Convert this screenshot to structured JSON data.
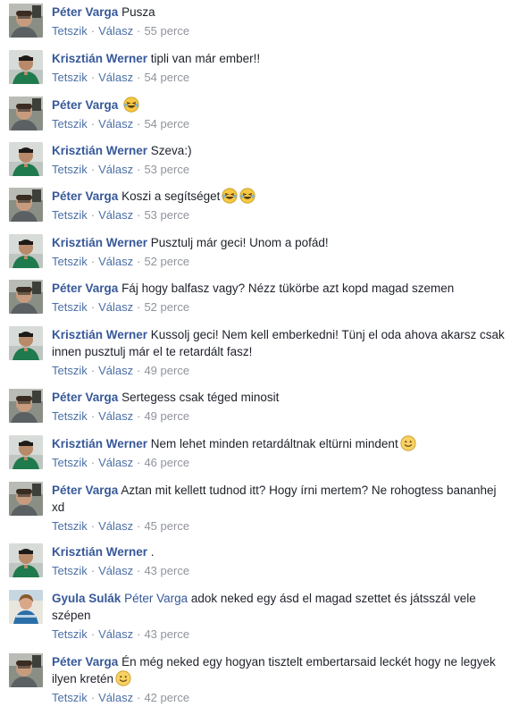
{
  "actions": {
    "like": "Tetszik",
    "reply": "Válasz",
    "separator": "·"
  },
  "comments": [
    {
      "author": "Péter Varga",
      "mention": "",
      "text": "Pusza",
      "emoji": [],
      "time": "55 perce",
      "avatar": "peter-avatar"
    },
    {
      "author": "Krisztián Werner",
      "mention": "",
      "text": "tipli van már ember!!",
      "emoji": [],
      "time": "54 perce",
      "avatar": "krisztian-avatar"
    },
    {
      "author": "Péter Varga",
      "mention": "",
      "text": "",
      "emoji": [
        "laughing-tears-emoji"
      ],
      "time": "54 perce",
      "avatar": "peter-avatar"
    },
    {
      "author": "Krisztián Werner",
      "mention": "",
      "text": "Szeva:)",
      "emoji": [],
      "time": "53 perce",
      "avatar": "krisztian-avatar"
    },
    {
      "author": "Péter Varga",
      "mention": "",
      "text": "Koszi a segítséget",
      "emoji": [
        "laughing-tears-emoji",
        "laughing-tears-emoji"
      ],
      "time": "53 perce",
      "avatar": "peter-avatar"
    },
    {
      "author": "Krisztián Werner",
      "mention": "",
      "text": "Pusztulj már geci! Unom a pofád!",
      "emoji": [],
      "time": "52 perce",
      "avatar": "krisztian-avatar"
    },
    {
      "author": "Péter Varga",
      "mention": "",
      "text": "Fáj hogy balfasz vagy? Nézz tükörbe azt kopd magad szemen",
      "emoji": [],
      "time": "52 perce",
      "avatar": "peter-avatar"
    },
    {
      "author": "Krisztián Werner",
      "mention": "",
      "text": "Kussolj geci! Nem kell emberkedni! Tünj el oda ahova akarsz csak innen pusztulj már el te retardált fasz!",
      "emoji": [],
      "time": "49 perce",
      "avatar": "krisztian-avatar"
    },
    {
      "author": "Péter Varga",
      "mention": "",
      "text": "Sertegess csak téged minosit",
      "emoji": [],
      "time": "49 perce",
      "avatar": "peter-avatar"
    },
    {
      "author": "Krisztián Werner",
      "mention": "",
      "text": "Nem lehet minden retardáltnak eltürni mindent",
      "emoji": [
        "slight-smile-emoji"
      ],
      "time": "46 perce",
      "avatar": "krisztian-avatar"
    },
    {
      "author": "Péter Varga",
      "mention": "",
      "text": "Aztan mit kellett tudnod itt? Hogy írni mertem? Ne rohogtess bananhej xd",
      "emoji": [],
      "time": "45 perce",
      "avatar": "peter-avatar"
    },
    {
      "author": "Krisztián Werner",
      "mention": "",
      "text": ".",
      "emoji": [],
      "time": "43 perce",
      "avatar": "krisztian-avatar"
    },
    {
      "author": "Gyula Sulák",
      "mention": "Péter Varga",
      "text": "adok neked egy ásd el magad szettet és játsszál vele szépen",
      "emoji": [],
      "time": "43 perce",
      "avatar": "gyula-avatar"
    },
    {
      "author": "Péter Varga",
      "mention": "",
      "text": "Én még neked egy hogyan tisztelt embertarsaid leckét hogy ne legyek ilyen kretén",
      "emoji": [
        "slight-smile-emoji"
      ],
      "time": "42 perce",
      "avatar": "peter-avatar"
    }
  ]
}
